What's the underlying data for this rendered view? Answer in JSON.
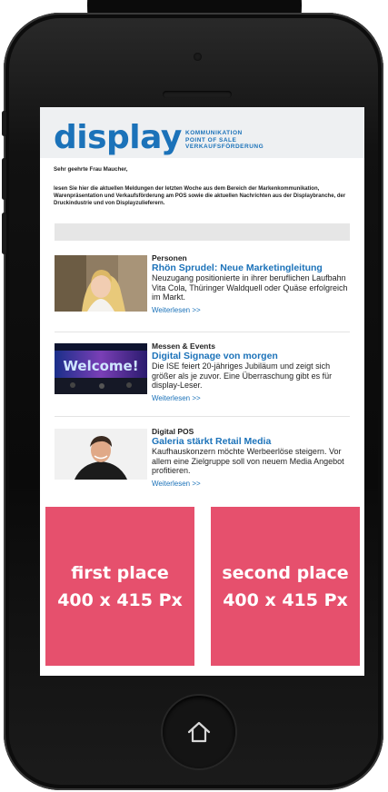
{
  "logo": {
    "word": "display",
    "tagline": [
      "KOMMUNIKATION",
      "POINT OF SALE",
      "VERKAUFSFÖRDERUNG"
    ]
  },
  "greeting": "Sehr geehrte Frau Maucher,",
  "intro": "lesen Sie hier die aktuellen Meldungen der letzten Woche aus dem Bereich der Markenkommunikation, Warenpräsentation und Verkaufsförderung am POS sowie die aktuellen Nachrichten aus der Displaybranche, der Druckindustrie und von Displayzulieferern.",
  "articles": [
    {
      "category": "Personen",
      "headline": "Rhön Sprudel: Neue Marketingleitung",
      "teaser": "Neuzugang positionierte in ihrer beruflichen Laufbahn Vita Cola, Thüringer Waldquell oder Quäse erfolgreich im Markt.",
      "more": "Weiterlesen >>"
    },
    {
      "category": "Messen & Events",
      "headline": "Digital Signage von morgen",
      "teaser": "Die ISE feiert 20-jähriges Jubiläum und zeigt sich größer als je zuvor. Eine Überraschung gibt es für display-Leser.",
      "more": "Weiterlesen >>",
      "image_text": "Welcome!"
    },
    {
      "category": "Digital POS",
      "headline": "Galeria stärkt Retail Media",
      "teaser": "Kaufhauskonzern möchte Werbeerlöse steigern. Vor allem eine Zielgruppe soll von neuem Media Angebot profitieren.",
      "more": "Weiterlesen >>"
    }
  ],
  "ads": [
    {
      "line1": "first place",
      "line2": "400 x 415 Px"
    },
    {
      "line1": "second place",
      "line2": "400 x 415 Px"
    }
  ],
  "colors": {
    "brand_blue": "#1b72b9",
    "ad_pink": "#e6506d",
    "phone_black": "#0b0b0b"
  },
  "icons": {
    "home": "home-icon"
  }
}
